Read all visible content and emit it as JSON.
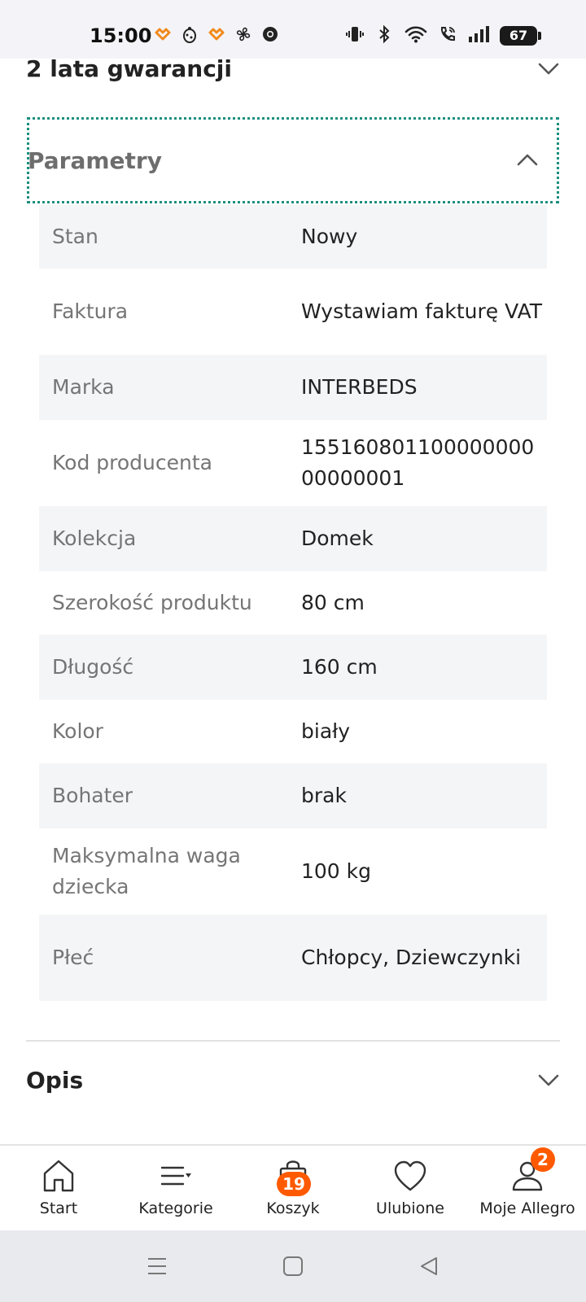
{
  "status_bar": {
    "time": "15:00",
    "battery": "67",
    "left_icons": [
      "allegro-heart-icon",
      "ladybug-icon",
      "allegro-heart-icon",
      "fan-icon",
      "chrome-icon"
    ],
    "right_icons": [
      "vibrate-icon",
      "bluetooth-icon",
      "wifi-icon",
      "wifi-call-icon",
      "signal-icon",
      "battery-icon"
    ]
  },
  "sections": {
    "warranty_title": "2 lata gwarancji",
    "params_title": "Parametry",
    "description_title": "Opis"
  },
  "parameters": [
    {
      "label": "Stan",
      "value": "Nowy"
    },
    {
      "label": "Faktura",
      "value": "Wystawiam fakturę VAT"
    },
    {
      "label": "Marka",
      "value": "INTERBEDS"
    },
    {
      "label": "Kod producenta",
      "value": "15516080110000000000000001"
    },
    {
      "label": "Kolekcja",
      "value": "Domek"
    },
    {
      "label": "Szerokość produktu",
      "value": "80 cm"
    },
    {
      "label": "Długość",
      "value": "160 cm"
    },
    {
      "label": "Kolor",
      "value": "biały"
    },
    {
      "label": "Bohater",
      "value": "brak"
    },
    {
      "label": "Maksymalna waga dziecka",
      "value": "100 kg"
    },
    {
      "label": "Płeć",
      "value": "Chłopcy, Dziewczynki"
    }
  ],
  "bottom_nav": [
    {
      "label": "Start",
      "icon": "home-icon"
    },
    {
      "label": "Kategorie",
      "icon": "categories-icon"
    },
    {
      "label": "Koszyk",
      "icon": "cart-bag-icon",
      "badge": "19"
    },
    {
      "label": "Ulubione",
      "icon": "heart-icon"
    },
    {
      "label": "Moje Allegro",
      "icon": "user-icon",
      "badge": "2"
    }
  ],
  "colors": {
    "accent": "#ff5a00",
    "focus_outline": "#1a8f7e",
    "alt_row": "#f4f5f7"
  }
}
